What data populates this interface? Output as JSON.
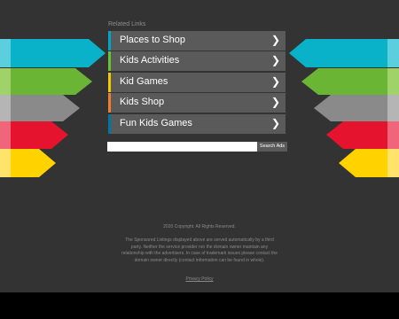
{
  "related_links": {
    "title": "Related Links",
    "items": [
      {
        "label": "Places to Shop",
        "accent": "#00a5c9"
      },
      {
        "label": "Kids Activities",
        "accent": "#6bc035"
      },
      {
        "label": "Kid Games",
        "accent": "#f5c800"
      },
      {
        "label": "Kids Shop",
        "accent": "#f07e2e"
      },
      {
        "label": "Fun Kids Games",
        "accent": "#0076a8"
      }
    ]
  },
  "search": {
    "placeholder": "",
    "button_label": "Search Ads"
  },
  "footer": {
    "copyright": "2020 Copyright. All Rights Reserved.",
    "disclaimer": "The Sponsored Listings displayed above are served automatically by a third party. Neither the service provider nor the domain owner maintain any relationship with the advertisers. In case of trademark issues please contact the domain owner directly (contact information can be found in whois).",
    "privacy_label": "Privacy Policy"
  },
  "decor": {
    "colors": [
      "#0ab2c9",
      "#6bb534",
      "#8a8a8a",
      "#e5132d",
      "#ffd200"
    ]
  }
}
